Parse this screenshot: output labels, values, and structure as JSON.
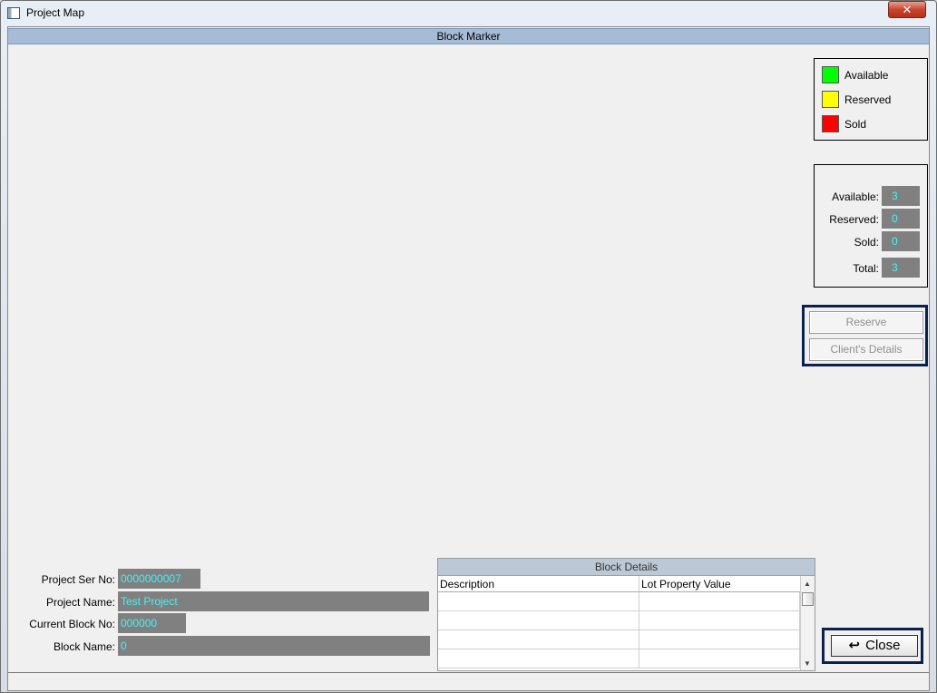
{
  "window": {
    "title": "Project Map",
    "close_glyph": "✕"
  },
  "header": {
    "title": "Block Marker"
  },
  "legend": {
    "items": [
      {
        "label": "Available",
        "color": "#00ff00"
      },
      {
        "label": "Reserved",
        "color": "#ffff00"
      },
      {
        "label": "Sold",
        "color": "#ff0000"
      }
    ]
  },
  "stats": {
    "available": {
      "label": "Available:",
      "value": "3"
    },
    "reserved": {
      "label": "Reserved:",
      "value": "0"
    },
    "sold": {
      "label": "Sold:",
      "value": "0"
    },
    "total": {
      "label": "Total:",
      "value": "3"
    }
  },
  "actions": {
    "reserve_label": "Reserve",
    "client_details_label": "Client's Details"
  },
  "project": {
    "ser_no_label": "Project Ser No:",
    "ser_no": "0000000007",
    "name_label": "Project Name:",
    "name": "Test Project",
    "block_no_label": "Current Block No:",
    "block_no": "000000",
    "block_name_label": "Block Name:",
    "block_name": "0"
  },
  "block_details": {
    "title": "Block Details",
    "columns": [
      "Description",
      "Lot Property Value"
    ]
  },
  "close_button": {
    "label": "Close",
    "icon": "return-arrow-icon"
  },
  "colors": {
    "header_bar": "#a6bcd6",
    "value_bg": "#808080",
    "value_text": "#3ff4f4",
    "frame": "#0a2050"
  }
}
